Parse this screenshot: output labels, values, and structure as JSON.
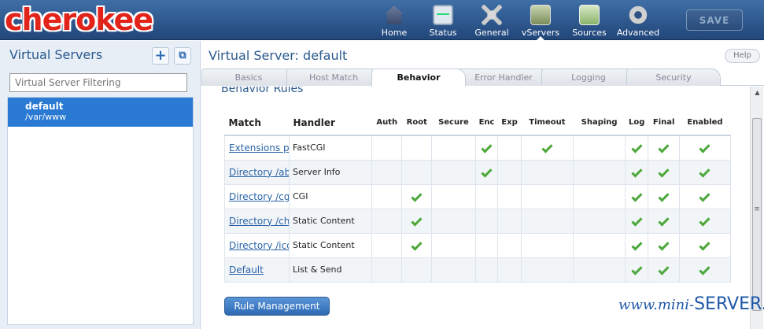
{
  "app": {
    "logo_text": "cherokee",
    "save_label": "SAVE"
  },
  "nav": [
    {
      "label": "Home",
      "icon": "home-icon"
    },
    {
      "label": "Status",
      "icon": "status-icon"
    },
    {
      "label": "General",
      "icon": "tools-icon"
    },
    {
      "label": "vServers",
      "icon": "vservers-icon",
      "active": true
    },
    {
      "label": "Sources",
      "icon": "sources-icon"
    },
    {
      "label": "Advanced",
      "icon": "gear-icon"
    }
  ],
  "sidebar": {
    "title": "Virtual Servers",
    "filter_placeholder": "Virtual Server Filtering",
    "items": [
      {
        "name": "default",
        "path": "/var/www",
        "selected": true
      }
    ]
  },
  "main": {
    "title": "Virtual Server: default",
    "help_label": "Help",
    "tabs": [
      {
        "label": "Basics"
      },
      {
        "label": "Host Match"
      },
      {
        "label": "Behavior",
        "active": true
      },
      {
        "label": "Error Handler"
      },
      {
        "label": "Logging"
      },
      {
        "label": "Security"
      }
    ],
    "section_title": "Behavior Rules",
    "rule_button_label": "Rule Management"
  },
  "rules_table": {
    "headers": [
      "Match",
      "Handler",
      "Auth",
      "Root",
      "Secure",
      "Enc",
      "Exp",
      "Timeout",
      "Shaping",
      "Log",
      "Final",
      "Enabled"
    ],
    "rows": [
      {
        "match": "Extensions php",
        "handler": "FastCGI",
        "flags": [
          false,
          false,
          false,
          true,
          false,
          true,
          false,
          true,
          true,
          true
        ]
      },
      {
        "match": "Directory /about",
        "handler": "Server Info",
        "flags": [
          false,
          false,
          false,
          true,
          false,
          false,
          false,
          true,
          true,
          true
        ]
      },
      {
        "match": "Directory /cgi-bin",
        "handler": "CGI",
        "flags": [
          false,
          true,
          false,
          false,
          false,
          false,
          false,
          true,
          true,
          true
        ]
      },
      {
        "match": "Directory /cherokee_themes",
        "handler": "Static Content",
        "flags": [
          false,
          true,
          false,
          false,
          false,
          false,
          false,
          true,
          true,
          true
        ]
      },
      {
        "match": "Directory /icons",
        "handler": "Static Content",
        "flags": [
          false,
          true,
          false,
          false,
          false,
          false,
          false,
          true,
          true,
          true
        ]
      },
      {
        "match": "Default",
        "handler": "List & Send",
        "flags": [
          false,
          false,
          false,
          false,
          false,
          false,
          false,
          true,
          true,
          true
        ]
      }
    ]
  },
  "watermark": {
    "prefix": "www.",
    "middle": "mini-",
    "suffix": "SERVER.ru"
  },
  "colors": {
    "header_top": "#3f6fa6",
    "header_bottom": "#21467a",
    "selected_item": "#2a7ad3",
    "check_green": "#4ca83a",
    "link_blue": "#2b64a8"
  }
}
